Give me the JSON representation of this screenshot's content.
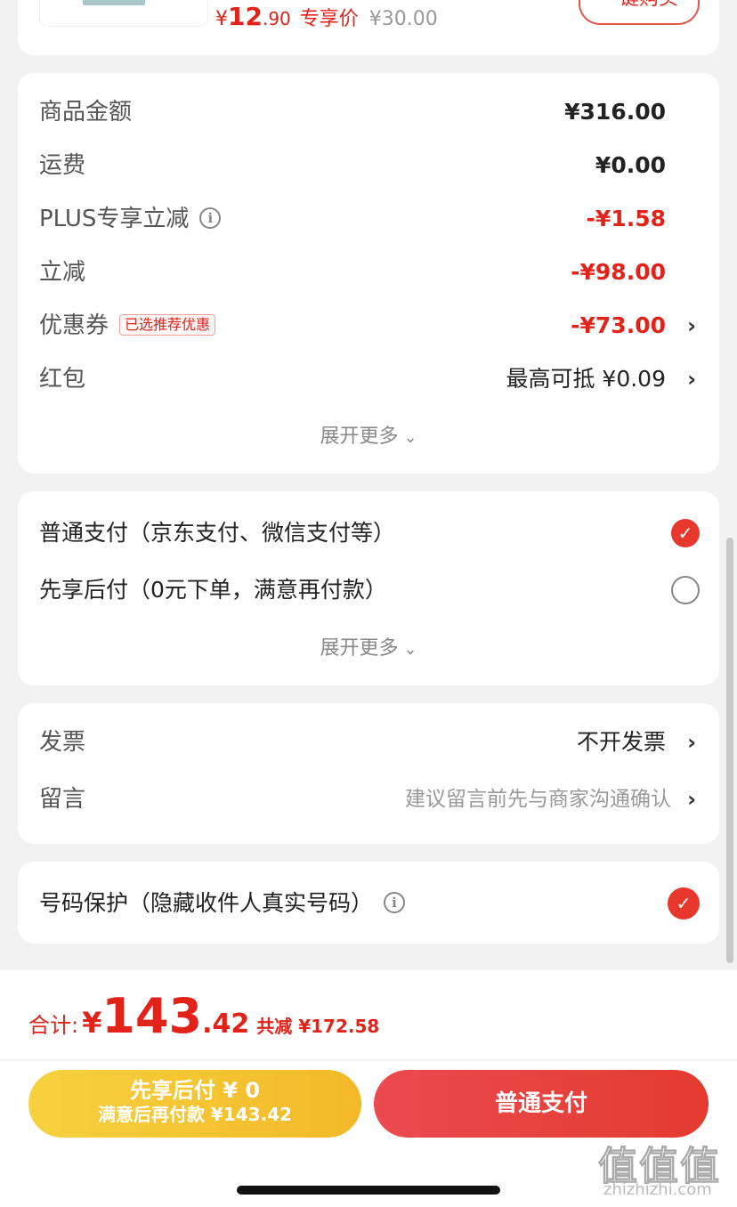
{
  "product": {
    "price_yen": "¥",
    "price_int": "12",
    "price_dec": ".90",
    "price_tag": "专享价",
    "original_price": "¥30.00",
    "buy_button": "一键购买"
  },
  "amounts": {
    "rows": [
      {
        "label": "商品金额",
        "value": "¥316.00"
      },
      {
        "label": "运费",
        "value": "¥0.00"
      },
      {
        "label": "PLUS专享立减",
        "value": "-¥1.58"
      },
      {
        "label": "立减",
        "value": "-¥98.00"
      },
      {
        "label": "优惠券",
        "tag": "已选推荐优惠",
        "value": "-¥73.00"
      },
      {
        "label": "红包",
        "value": "最高可抵 ¥0.09"
      }
    ],
    "expand_label": "展开更多"
  },
  "payment": {
    "options": [
      {
        "label": "普通支付（京东支付、微信支付等）",
        "selected": true
      },
      {
        "label": "先享后付（0元下单，满意再付款）",
        "selected": false
      }
    ],
    "expand_label": "展开更多"
  },
  "invoice": {
    "invoice_label": "发票",
    "invoice_value": "不开发票",
    "message_label": "留言",
    "message_placeholder": "建议留言前先与商家沟通确认"
  },
  "privacy": {
    "label": "号码保护（隐藏收件人真实号码）",
    "checked": true
  },
  "footer": {
    "total_label": "合计:",
    "total_yen": "¥",
    "total_int": "143",
    "total_dec": ".42",
    "total_saved": "共减 ¥172.58",
    "bnpl_line1": "先享后付 ¥ 0",
    "bnpl_line2": "满意后再付款 ¥143.42",
    "pay_button": "普通支付"
  },
  "watermark": {
    "main": "值值值",
    "sub": "zhizhizhi.com"
  },
  "colors": {
    "accent_red": "#e2231a",
    "yellow_button": "#f2b928",
    "red_button": "#e43b2f",
    "background": "#f2f2f2"
  }
}
